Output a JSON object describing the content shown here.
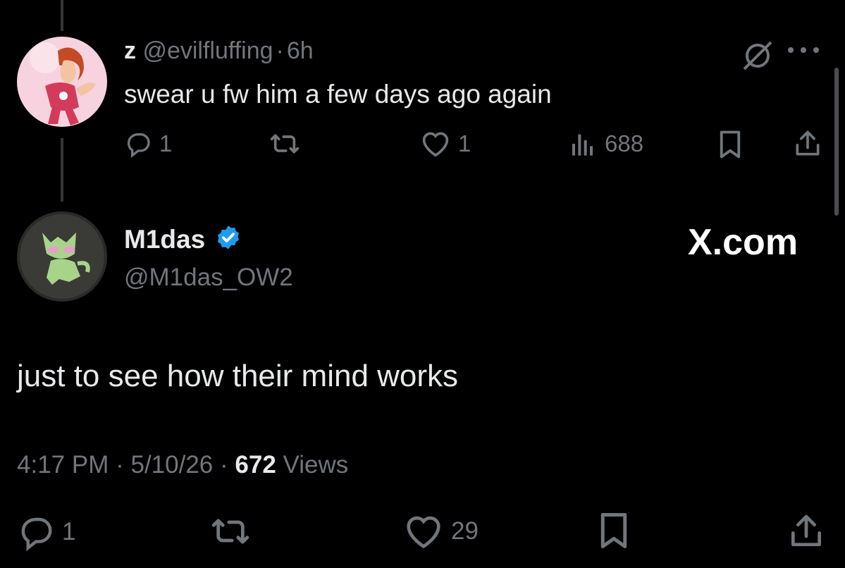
{
  "reply": {
    "display_name": "z",
    "handle": "@evilfluffing",
    "separator": "·",
    "time": "6h",
    "text": "swear u fw him a few days ago again",
    "actions": {
      "replies": "1",
      "likes": "1",
      "views": "688"
    }
  },
  "tweet": {
    "display_name": "M1das",
    "handle": "@M1das_OW2",
    "watermark": "X.com",
    "text": "just to see how their mind works",
    "meta": {
      "time": "4:17 PM",
      "date": "5/10/26",
      "sep1": "·",
      "sep2": "·",
      "views_count": "672",
      "views_label": "Views"
    },
    "actions": {
      "replies": "1",
      "likes": "29"
    }
  },
  "icons": {
    "reply": "reply-icon",
    "retweet": "retweet-icon",
    "like": "heart-icon",
    "views": "views-chart-icon",
    "bookmark": "bookmark-icon",
    "share": "share-icon",
    "mute": "muted-icon",
    "more": "more-icon",
    "verified": "verified-badge-icon"
  },
  "colors": {
    "background": "#000000",
    "text": "#e7e9ea",
    "muted": "#71767b",
    "verified": "#1d9bf0",
    "thread_line": "#333639"
  }
}
